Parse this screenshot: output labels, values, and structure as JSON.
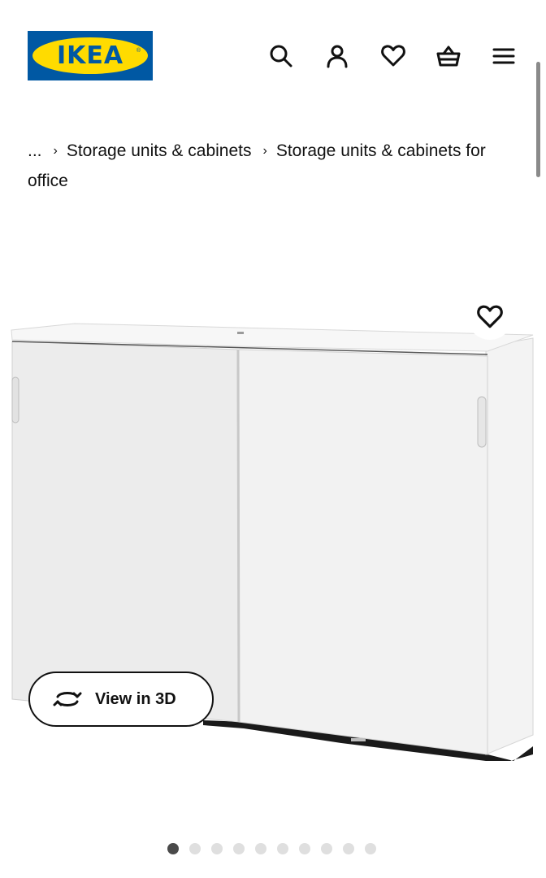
{
  "header": {
    "logo_text": "IKEA",
    "logo_registered": "®",
    "brand_colors": {
      "blue": "#0058a3",
      "yellow": "#ffdb00"
    },
    "icons": [
      "search-icon",
      "account-icon",
      "heart-icon",
      "basket-icon",
      "menu-icon"
    ]
  },
  "breadcrumb": {
    "ellipsis": "...",
    "separator": "›",
    "items": [
      {
        "label": "Storage units & cabinets"
      },
      {
        "label": "Storage units & cabinets for office"
      }
    ]
  },
  "product": {
    "favorite_icon": "heart-icon",
    "view3d": {
      "label": "View in 3D",
      "icon": "rotate-3d-icon"
    }
  },
  "carousel": {
    "total_images": 10,
    "active_index": 0
  }
}
